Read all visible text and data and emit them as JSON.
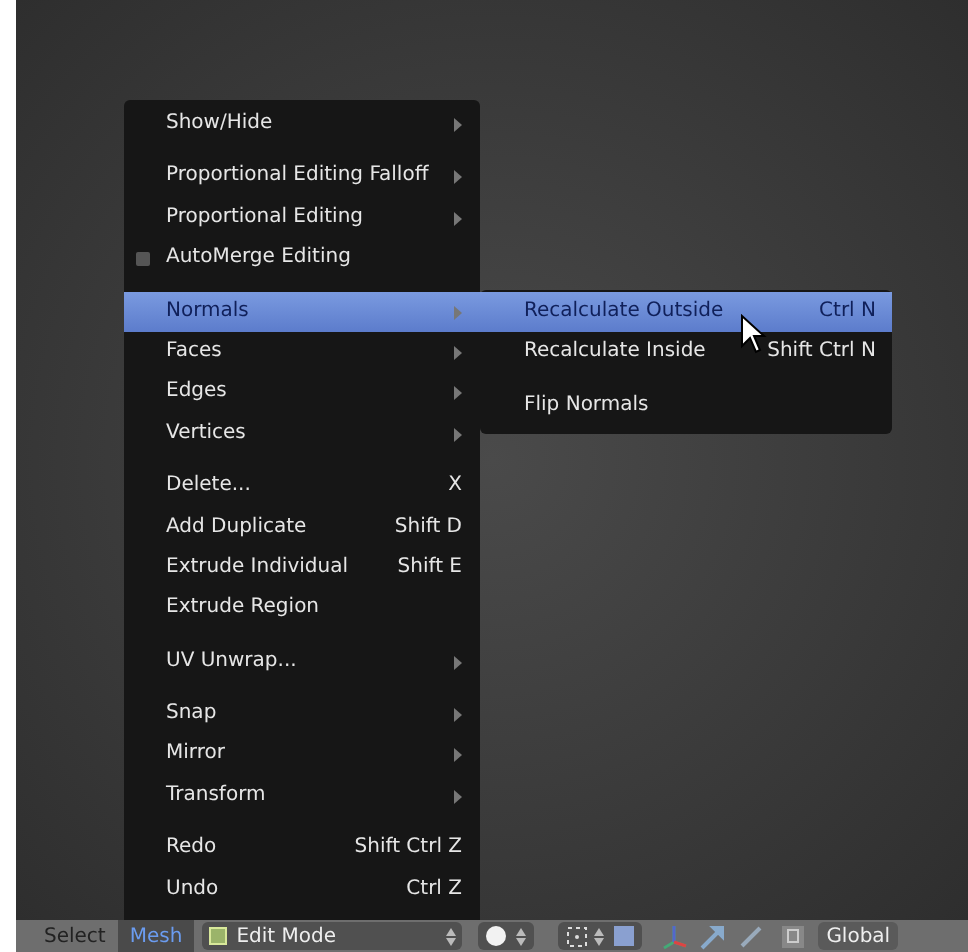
{
  "menu": {
    "sections": [
      [
        {
          "kind": "submenu",
          "label": "Show/Hide",
          "selected": false
        }
      ],
      [
        {
          "kind": "submenu",
          "label": "Proportional Editing Falloff",
          "selected": false
        },
        {
          "kind": "submenu",
          "label": "Proportional Editing",
          "selected": false
        },
        {
          "kind": "checkbox",
          "label": "AutoMerge Editing",
          "checked": false,
          "selected": false
        }
      ],
      [
        {
          "kind": "submenu",
          "label": "Normals",
          "selected": true
        },
        {
          "kind": "submenu",
          "label": "Faces",
          "selected": false
        },
        {
          "kind": "submenu",
          "label": "Edges",
          "selected": false
        },
        {
          "kind": "submenu",
          "label": "Vertices",
          "selected": false
        }
      ],
      [
        {
          "kind": "shortcut",
          "label": "Delete...",
          "shortcut": "X",
          "selected": false
        },
        {
          "kind": "shortcut",
          "label": "Add Duplicate",
          "shortcut": "Shift D",
          "selected": false
        },
        {
          "kind": "shortcut",
          "label": "Extrude Individual",
          "shortcut": "Shift E",
          "selected": false
        },
        {
          "kind": "shortcut",
          "label": "Extrude Region",
          "selected": false
        }
      ],
      [
        {
          "kind": "submenu",
          "label": "UV Unwrap...",
          "selected": false
        }
      ],
      [
        {
          "kind": "submenu",
          "label": "Snap",
          "selected": false
        },
        {
          "kind": "submenu",
          "label": "Mirror",
          "selected": false
        },
        {
          "kind": "submenu",
          "label": "Transform",
          "selected": false
        }
      ],
      [
        {
          "kind": "shortcut",
          "label": "Redo",
          "shortcut": "Shift Ctrl Z",
          "selected": false
        },
        {
          "kind": "shortcut",
          "label": "Undo",
          "shortcut": "Ctrl Z",
          "selected": false
        }
      ]
    ]
  },
  "submenu": {
    "sections": [
      [
        {
          "label": "Recalculate Outside",
          "shortcut": "Ctrl N",
          "selected": true
        },
        {
          "label": "Recalculate Inside",
          "shortcut": "Shift Ctrl N",
          "selected": false
        }
      ],
      [
        {
          "label": "Flip Normals",
          "selected": false
        }
      ]
    ]
  },
  "header": {
    "menus": [
      {
        "label": "Select",
        "selected": false
      },
      {
        "label": "Mesh",
        "selected": true
      }
    ],
    "mode": "Edit Mode",
    "orientation": "Global"
  }
}
